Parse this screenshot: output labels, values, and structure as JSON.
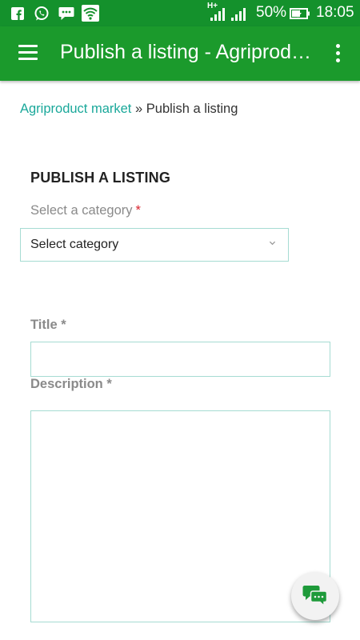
{
  "statusbar": {
    "network_type": "H+",
    "battery": "50%",
    "time": "18:05",
    "icons": [
      "facebook-icon",
      "whatsapp-icon",
      "messenger-icon",
      "wifi-icon",
      "signal-icon",
      "battery-icon"
    ]
  },
  "appbar": {
    "title": "Publish a listing - Agriproduct market",
    "icons": [
      "menu-icon",
      "more-vert-icon"
    ]
  },
  "breadcrumb": {
    "home": "Agriproduct market",
    "separator": "»",
    "current": "Publish a listing"
  },
  "form": {
    "heading": "PUBLISH A LISTING",
    "category_label": "Select a category",
    "category_required": "*",
    "category_value": "Select category",
    "title_label": "Title *",
    "title_value": "",
    "description_label": "Description *",
    "description_value": ""
  },
  "fab": {
    "icon": "chat-bubbles-icon",
    "color": "#1e9a3a"
  },
  "colors": {
    "primary": "#1b9a2c",
    "link": "#1aa89a",
    "required": "#d9232e",
    "input_border": "#a6dcd2"
  }
}
